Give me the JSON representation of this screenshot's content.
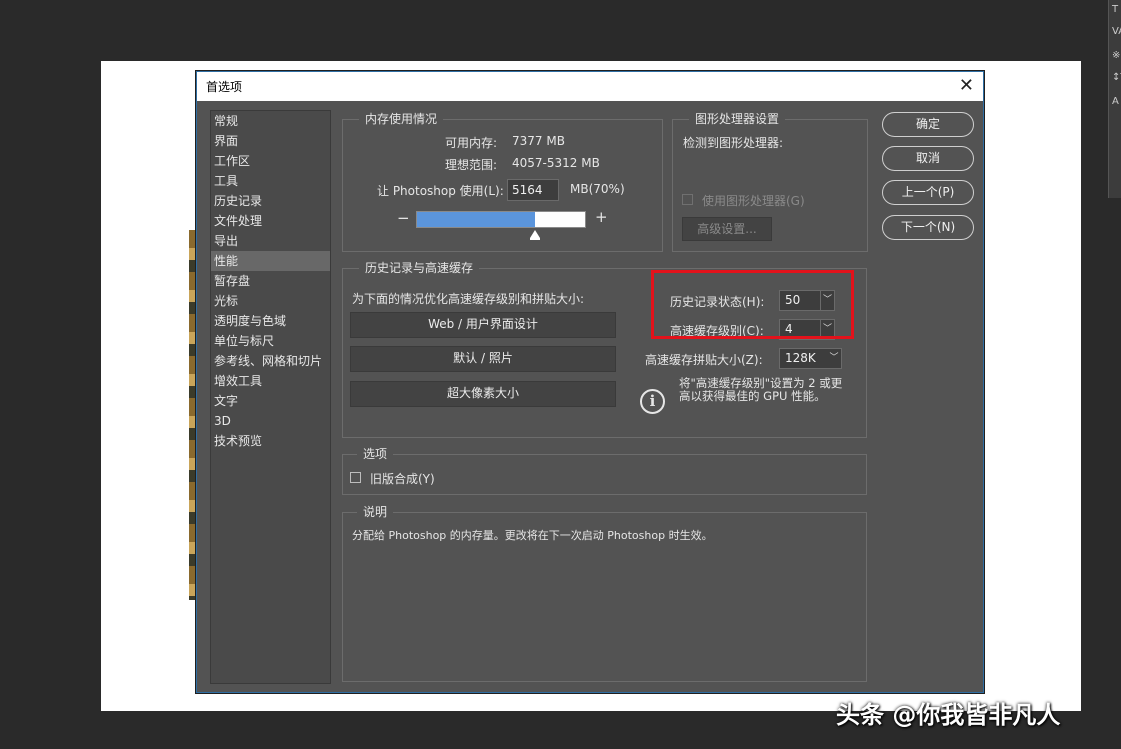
{
  "window": {
    "title": "首选项",
    "close_glyph": "✕"
  },
  "nav": {
    "items": [
      {
        "label": "常规",
        "selected": false
      },
      {
        "label": "界面",
        "selected": false
      },
      {
        "label": "工作区",
        "selected": false
      },
      {
        "label": "工具",
        "selected": false
      },
      {
        "label": "历史记录",
        "selected": false
      },
      {
        "label": "文件处理",
        "selected": false
      },
      {
        "label": "导出",
        "selected": false
      },
      {
        "label": "性能",
        "selected": true
      },
      {
        "label": "暂存盘",
        "selected": false
      },
      {
        "label": "光标",
        "selected": false
      },
      {
        "label": "透明度与色域",
        "selected": false
      },
      {
        "label": "单位与标尺",
        "selected": false
      },
      {
        "label": "参考线、网格和切片",
        "selected": false
      },
      {
        "label": "增效工具",
        "selected": false
      },
      {
        "label": "文字",
        "selected": false
      },
      {
        "label": "3D",
        "selected": false
      },
      {
        "label": "技术预览",
        "selected": false
      }
    ]
  },
  "memory": {
    "legend": "内存使用情况",
    "available_label": "可用内存:",
    "available_value": "7377 MB",
    "ideal_label": "理想范围:",
    "ideal_value": "4057-5312 MB",
    "use_label": "让 Photoshop 使用(L):",
    "use_value": "5164",
    "use_unit": "MB(70%)",
    "minus": "−",
    "plus": "+",
    "slider_fraction": 0.7
  },
  "gpu": {
    "legend": "图形处理器设置",
    "detected_label": "检测到图形处理器:",
    "use_gpu_label": "使用图形处理器(G)",
    "advanced_label": "高级设置..."
  },
  "history": {
    "legend": "历史记录与高速缓存",
    "optimize_label": "为下面的情况优化高速缓存级别和拼贴大小:",
    "btn_web": "Web / 用户界面设计",
    "btn_default": "默认 / 照片",
    "btn_huge": "超大像素大小",
    "states_label": "历史记录状态(H):",
    "states_value": "50",
    "levels_label": "高速缓存级别(C):",
    "levels_value": "4",
    "tile_label": "高速缓存拼贴大小(Z):",
    "tile_value": "128K",
    "tip_line1": "将\"高速缓存级别\"设置为 2 或更",
    "tip_line2": "高以获得最佳的 GPU 性能。",
    "info_glyph": "i"
  },
  "options": {
    "legend": "选项",
    "legacy_label": "旧版合成(Y)"
  },
  "description": {
    "legend": "说明",
    "text": "分配给 Photoshop 的内存量。更改将在下一次启动 Photoshop 时生效。"
  },
  "buttons": {
    "ok": "确定",
    "cancel": "取消",
    "prev": "上一个(P)",
    "next": "下一个(N)"
  },
  "colors": {
    "dialog_bg": "#535353",
    "selection": "#686868",
    "slider_fill": "#5b95dc",
    "highlight_box": "#e3121b"
  },
  "watermark": "头条 @你我皆非凡人",
  "side_panel": {
    "glyphs": [
      "T",
      "VA",
      "※",
      "↕T",
      "A"
    ]
  },
  "dropdown_glyph": "﹀"
}
